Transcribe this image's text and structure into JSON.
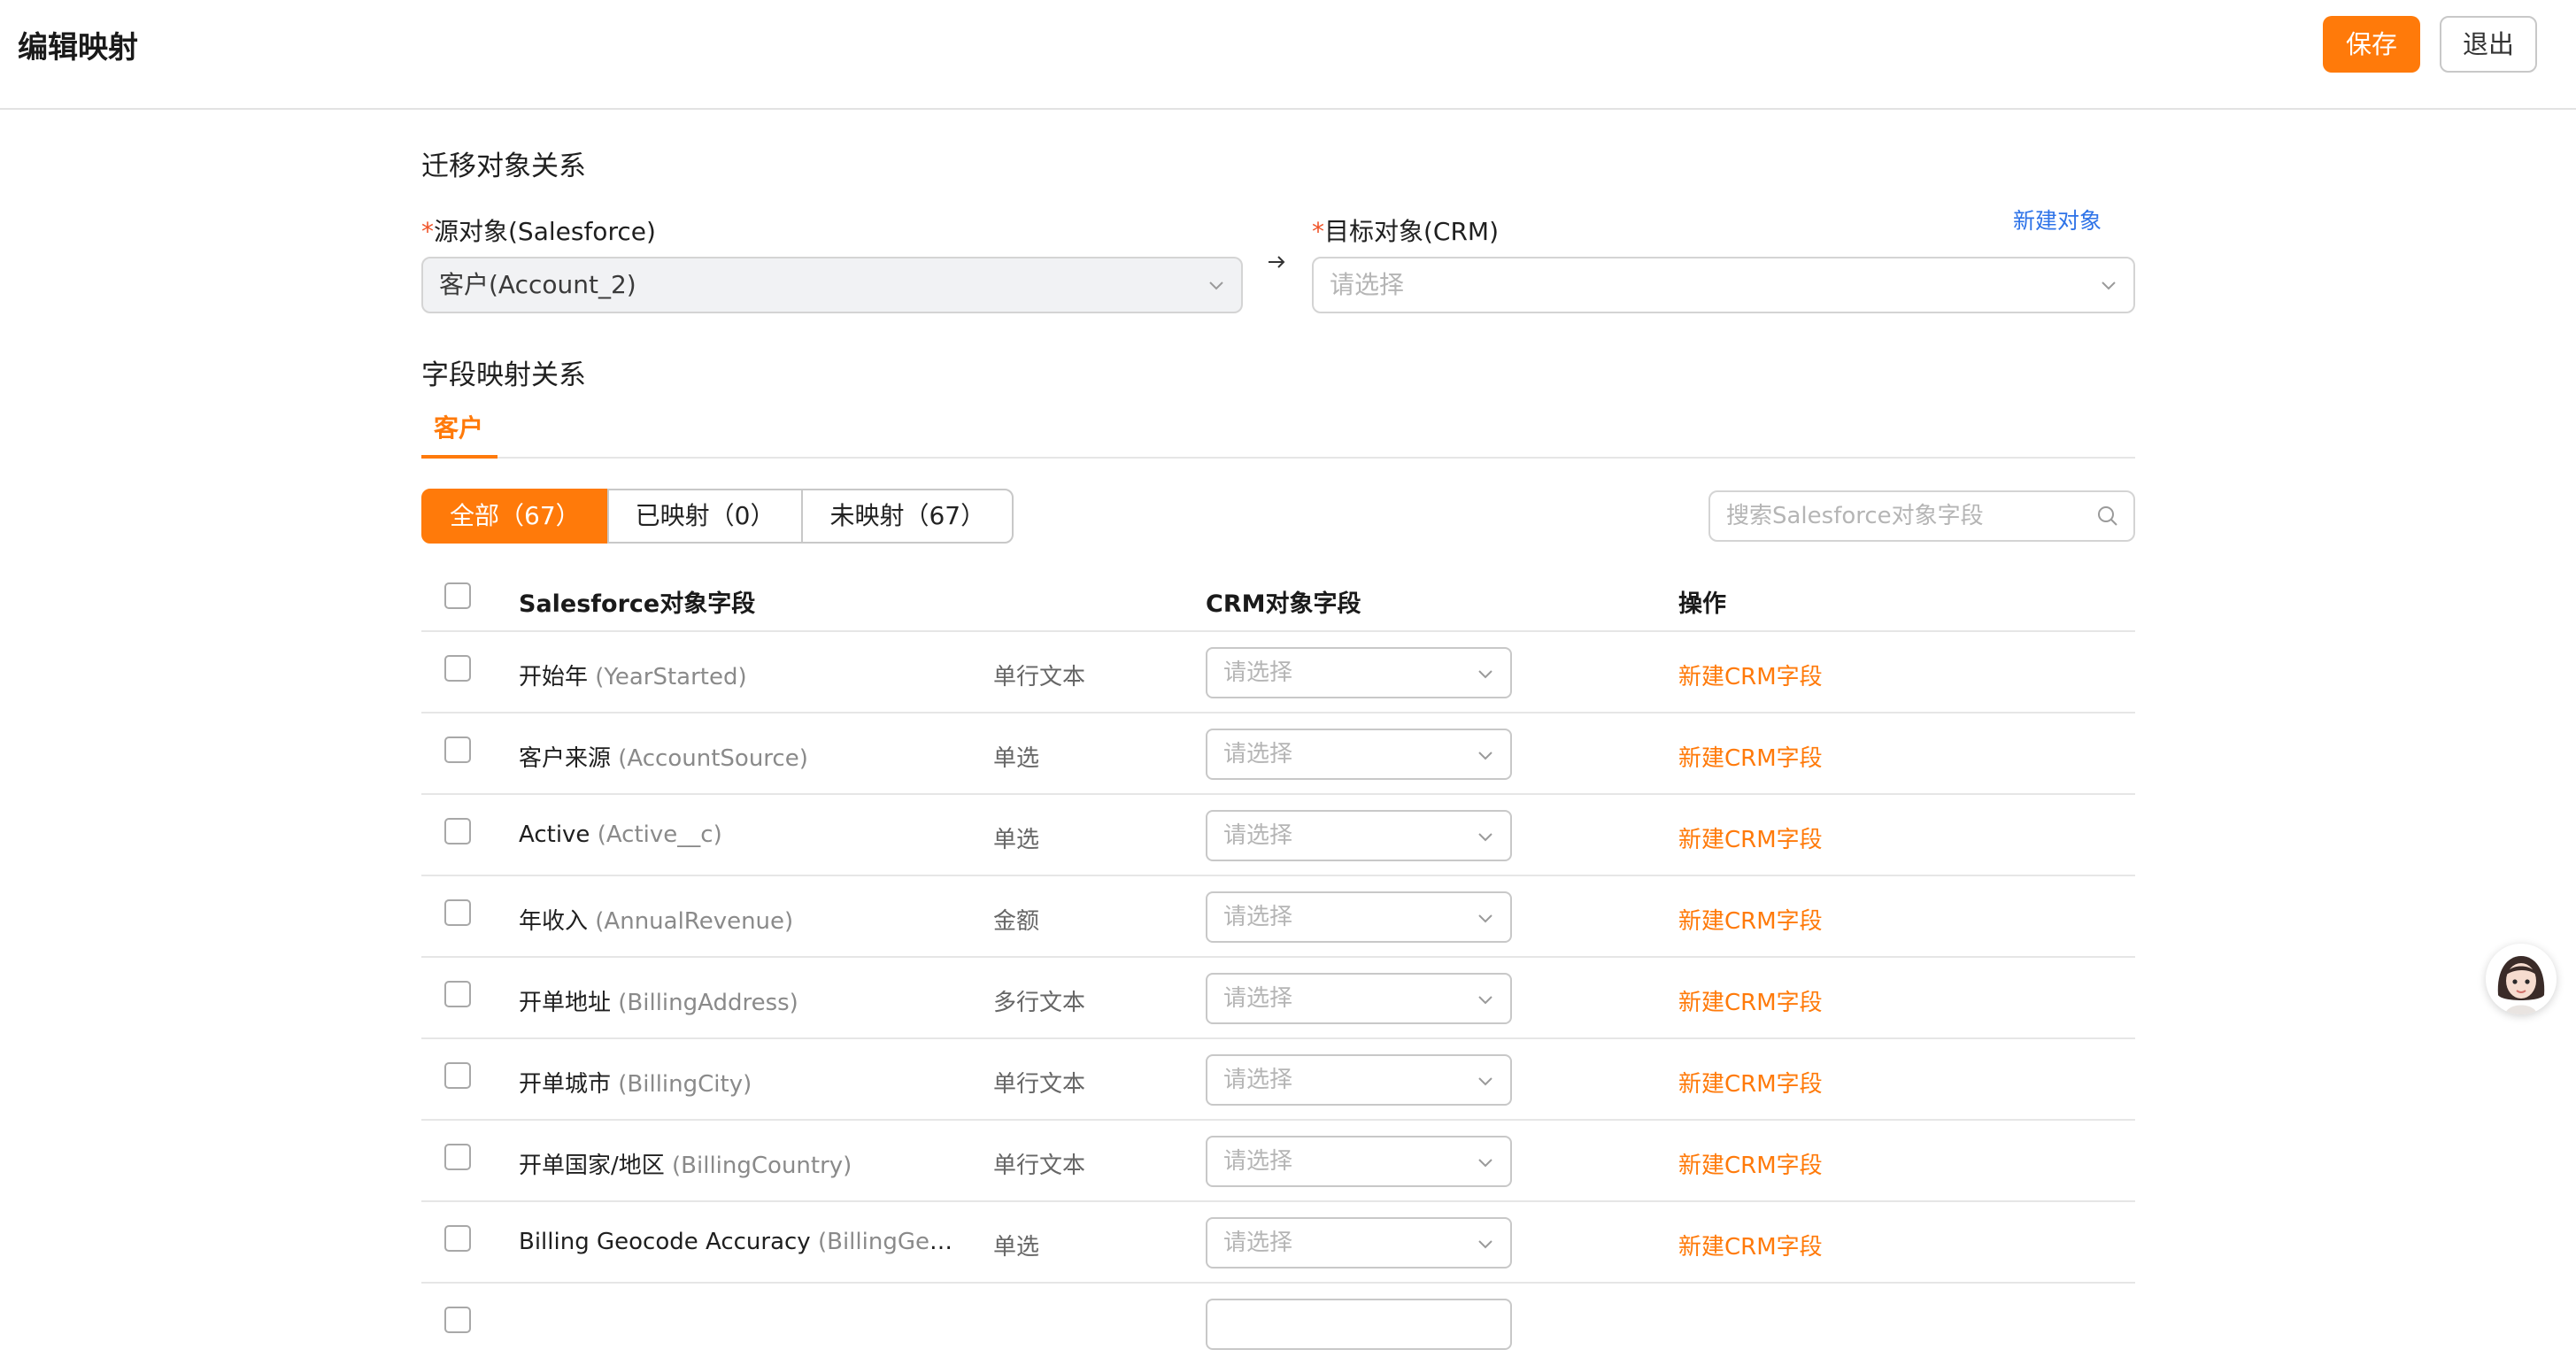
{
  "header": {
    "title": "编辑映射",
    "save_label": "保存",
    "exit_label": "退出"
  },
  "migration": {
    "section_title": "迁移对象关系",
    "source_required_mark": "*",
    "source_label": "源对象(Salesforce)",
    "source_value": "客户(Account_2)",
    "target_required_mark": "*",
    "target_label": "目标对象(CRM)",
    "target_placeholder": "请选择",
    "new_object_link": "新建对象"
  },
  "field_mapping": {
    "section_title": "字段映射关系",
    "tab": "客户",
    "filters": [
      {
        "label": "全部（67）",
        "active": true
      },
      {
        "label": "已映射（0）",
        "active": false
      },
      {
        "label": "未映射（67）",
        "active": false
      }
    ],
    "search_placeholder": "搜索Salesforce对象字段",
    "columns": {
      "source": "Salesforce对象字段",
      "crm": "CRM对象字段",
      "action": "操作"
    },
    "rows": [
      {
        "label": "开始年",
        "api": "(YearStarted)",
        "type": "单行文本",
        "select": "请选择",
        "action": "新建CRM字段"
      },
      {
        "label": "客户来源",
        "api": "(AccountSource)",
        "type": "单选",
        "select": "请选择",
        "action": "新建CRM字段"
      },
      {
        "label": "Active",
        "api": "(Active__c)",
        "type": "单选",
        "select": "请选择",
        "action": "新建CRM字段"
      },
      {
        "label": "年收入",
        "api": "(AnnualRevenue)",
        "type": "金额",
        "select": "请选择",
        "action": "新建CRM字段"
      },
      {
        "label": "开单地址",
        "api": "(BillingAddress)",
        "type": "多行文本",
        "select": "请选择",
        "action": "新建CRM字段"
      },
      {
        "label": "开单城市",
        "api": "(BillingCity)",
        "type": "单行文本",
        "select": "请选择",
        "action": "新建CRM字段"
      },
      {
        "label": "开单国家/地区",
        "api": "(BillingCountry)",
        "type": "单行文本",
        "select": "请选择",
        "action": "新建CRM字段"
      },
      {
        "label": "Billing Geocode Accuracy",
        "api": "(BillingGeocodeA…",
        "type": "单选",
        "select": "请选择",
        "action": "新建CRM字段"
      }
    ]
  },
  "colors": {
    "accent": "#ff7a0a",
    "link": "#2e73e8",
    "required": "#f0552a"
  }
}
